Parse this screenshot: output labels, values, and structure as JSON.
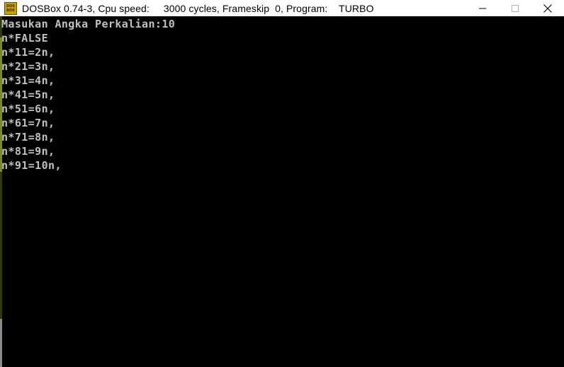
{
  "window": {
    "title": "DOSBox 0.74-3, Cpu speed:     3000 cycles, Frameskip  0, Program:    TURBO",
    "app_icon": {
      "name": "dosbox-icon",
      "label_top": "DOS",
      "label_bottom": "BOX"
    },
    "controls": {
      "minimize_icon": "minimize-icon",
      "maximize_icon": "maximize-icon",
      "close_icon": "close-icon"
    }
  },
  "console": {
    "lines": [
      "Masukan Angka Perkalian:10",
      "n*FALSE",
      "n*11=2n,",
      "n*21=3n,",
      "n*31=4n,",
      "n*41=5n,",
      "n*51=6n,",
      "n*61=7n,",
      "n*71=8n,",
      "n*81=9n,",
      "n*91=10n,"
    ],
    "text_color": "#c0c0c0",
    "background_color": "#000000"
  }
}
